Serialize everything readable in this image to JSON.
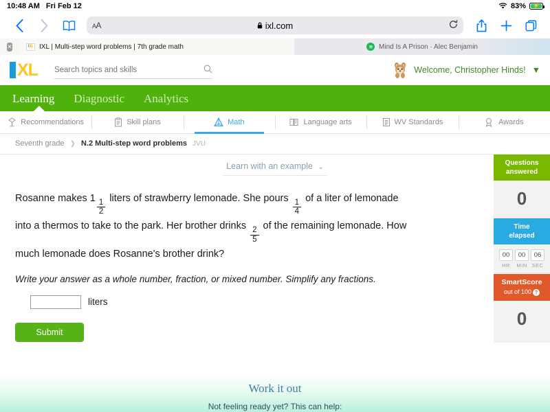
{
  "status_bar": {
    "time": "10:48 AM",
    "date": "Fri Feb 12",
    "battery_percent": "83%",
    "wifi_icon": "wifi-icon",
    "battery_icon": "battery-charging-icon"
  },
  "browser": {
    "back_icon": "chevron-left-icon",
    "forward_icon": "chevron-right-icon",
    "bookmarks_icon": "book-icon",
    "text_size_label": "AA",
    "lock_icon": "lock-icon",
    "url": "ixl.com",
    "reload_icon": "reload-icon",
    "share_icon": "share-icon",
    "new_tab_icon": "plus-icon",
    "tabs_overview_icon": "tabs-icon",
    "tabs": [
      {
        "title": "IXL | Multi-step word problems | 7th grade math",
        "favicon": "ixl-favicon",
        "active": true
      },
      {
        "title": "Mind Is A Prison · Alec Benjamin",
        "favicon": "spotify-favicon",
        "active": false
      }
    ],
    "close_tab_icon": "close-icon"
  },
  "site_header": {
    "logo_text_i": "I",
    "logo_text_xl": "XL",
    "search_placeholder": "Search topics and skills",
    "search_value": "",
    "search_icon": "search-icon",
    "avatar_icon": "squirrel-avatar",
    "welcome_text": "Welcome, Christopher Hinds!",
    "dropdown_icon": "chevron-down-icon"
  },
  "main_nav": [
    {
      "label": "Learning",
      "active": true
    },
    {
      "label": "Diagnostic",
      "active": false
    },
    {
      "label": "Analytics",
      "active": false
    }
  ],
  "subject_tabs": [
    {
      "label": "Recommendations",
      "icon": "recommendations-icon",
      "active": false
    },
    {
      "label": "Skill plans",
      "icon": "clipboard-icon",
      "active": false
    },
    {
      "label": "Math",
      "icon": "pyramid-icon",
      "active": true
    },
    {
      "label": "Language arts",
      "icon": "book-open-icon",
      "active": false
    },
    {
      "label": "WV Standards",
      "icon": "standards-icon",
      "active": false
    },
    {
      "label": "Awards",
      "icon": "ribbon-icon",
      "active": false
    }
  ],
  "breadcrumb": {
    "grade": "Seventh grade",
    "separator_icon": "chevron-right-icon",
    "skill": "N.2 Multi-step word problems",
    "skill_code": "JVU"
  },
  "learn_with_example": {
    "label": "Learn with an example",
    "chevron_icon": "chevron-down-icon"
  },
  "question": {
    "line1_a": "Rosanne makes 1",
    "frac1": {
      "num": "1",
      "den": "2"
    },
    "line1_b": " liters of strawberry lemonade. She pours ",
    "frac2": {
      "num": "1",
      "den": "4"
    },
    "line1_c": " of a liter of lemonade into a thermos to take to the park. Her brother drinks ",
    "frac3": {
      "num": "2",
      "den": "5"
    },
    "line1_d": " of the remaining lemonade. How much lemonade does Rosanne's brother drink?",
    "instruction": "Write your answer as a whole number, fraction, or mixed number. Simplify any fractions.",
    "answer_value": "",
    "answer_unit": "liters",
    "submit_label": "Submit"
  },
  "score_panel": {
    "questions_answered": {
      "title_line1": "Questions",
      "title_line2": "answered",
      "value": "0",
      "color": "#7ab800"
    },
    "time_elapsed": {
      "title_line1": "Time",
      "title_line2": "elapsed",
      "color": "#29abe2",
      "hours": "00",
      "minutes": "00",
      "seconds": "06",
      "hours_label": "HR",
      "minutes_label": "MIN",
      "seconds_label": "SEC"
    },
    "smartscore": {
      "title": "SmartScore",
      "subtitle": "out of 100",
      "help_icon": "question-mark-icon",
      "value": "0",
      "color": "#e0592a"
    }
  },
  "work_it_out": {
    "title": "Work it out",
    "subtitle": "Not feeling ready yet? This can help:"
  }
}
